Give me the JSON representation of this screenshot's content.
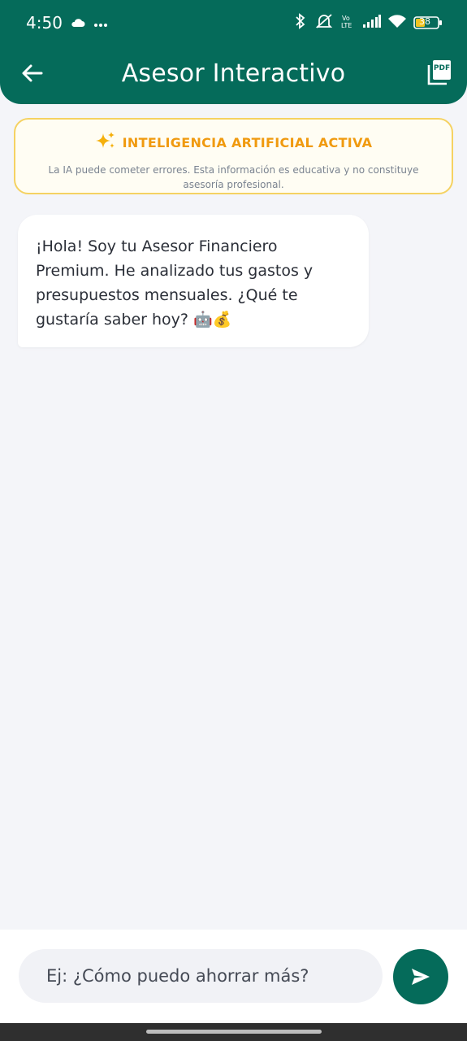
{
  "status_bar": {
    "time": "4:50",
    "battery": "38",
    "icons": [
      "cloud-icon",
      "more-dots-icon",
      "bluetooth-icon",
      "mute-icon",
      "volte-icon",
      "signal-icon",
      "wifi-icon",
      "battery-icon"
    ]
  },
  "app_bar": {
    "title": "Asesor Interactivo",
    "back_icon": "arrow-left-icon",
    "pdf_icon": "pdf-icon",
    "pdf_icon_text": "PDF"
  },
  "ai_banner": {
    "icon": "sparkles-icon",
    "title": "INTELIGENCIA ARTIFICIAL ACTIVA",
    "note": "La IA puede cometer errores. Esta información es educativa y no constituye asesoría profesional."
  },
  "chat": {
    "messages": [
      {
        "sender": "assistant",
        "text": "¡Hola! Soy tu Asesor Financiero Premium. He analizado tus gastos y presupuestos mensuales. ¿Qué te gustaría saber hoy? 🤖💰"
      }
    ]
  },
  "composer": {
    "placeholder": "Ej: ¿Cómo puedo ahorrar más?",
    "send_icon": "send-icon"
  },
  "colors": {
    "primary": "#056b5a",
    "accent": "#f09a0f",
    "banner_border": "#f5d262",
    "background": "#f4f5f9"
  }
}
